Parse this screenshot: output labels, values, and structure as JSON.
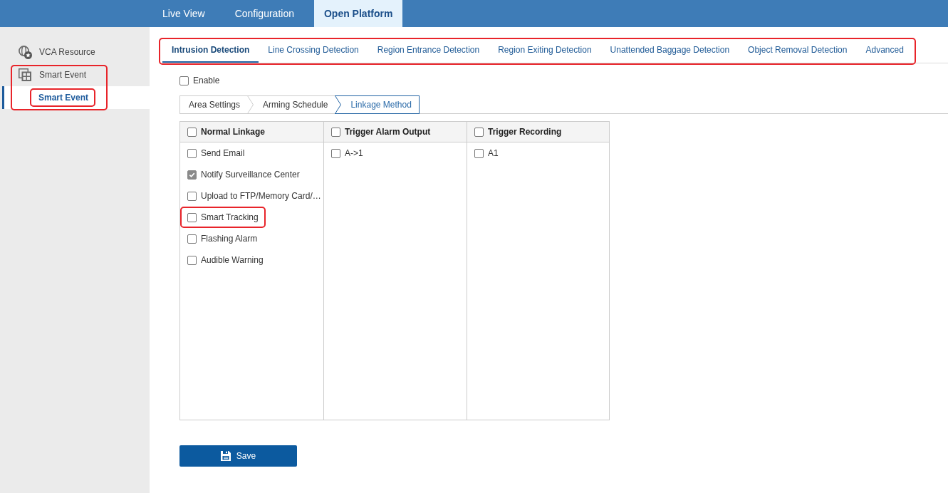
{
  "top_nav": {
    "items": [
      {
        "label": "Live View",
        "selected": false
      },
      {
        "label": "Configuration",
        "selected": false
      },
      {
        "label": "Open Platform",
        "selected": true
      }
    ]
  },
  "sidebar": {
    "items": [
      {
        "label": "VCA Resource",
        "selected": false,
        "highlighted": false
      },
      {
        "label": "Smart Event",
        "selected": false,
        "highlighted": true,
        "children": [
          {
            "label": "Smart Event",
            "selected": true,
            "highlighted": true
          }
        ]
      }
    ]
  },
  "detection_tabs": {
    "highlighted": true,
    "items": [
      {
        "label": "Intrusion Detection",
        "selected": true
      },
      {
        "label": "Line Crossing Detection",
        "selected": false
      },
      {
        "label": "Region Entrance Detection",
        "selected": false
      },
      {
        "label": "Region Exiting Detection",
        "selected": false
      },
      {
        "label": "Unattended Baggage Detection",
        "selected": false
      },
      {
        "label": "Object Removal Detection",
        "selected": false
      },
      {
        "label": "Advanced",
        "selected": false
      }
    ]
  },
  "enable": {
    "label": "Enable",
    "checked": false
  },
  "steps": [
    {
      "label": "Area Settings",
      "selected": false
    },
    {
      "label": "Arming Schedule",
      "selected": false
    },
    {
      "label": "Linkage Method",
      "selected": true
    }
  ],
  "linkage_table": {
    "columns": [
      {
        "label": "Normal Linkage",
        "checked": false,
        "options": [
          {
            "label": "Send Email",
            "checked": false,
            "highlighted": false
          },
          {
            "label": "Notify Surveillance Center",
            "checked": true,
            "highlighted": false
          },
          {
            "label": "Upload to FTP/Memory Card/…",
            "checked": false,
            "highlighted": false
          },
          {
            "label": "Smart Tracking",
            "checked": false,
            "highlighted": true
          },
          {
            "label": "Flashing Alarm",
            "checked": false,
            "highlighted": false
          },
          {
            "label": "Audible Warning",
            "checked": false,
            "highlighted": false
          }
        ]
      },
      {
        "label": "Trigger Alarm Output",
        "checked": false,
        "options": [
          {
            "label": "A->1",
            "checked": false,
            "highlighted": false
          }
        ]
      },
      {
        "label": "Trigger Recording",
        "checked": false,
        "options": [
          {
            "label": "A1",
            "checked": false,
            "highlighted": false
          }
        ]
      }
    ]
  },
  "save_button": {
    "label": "Save"
  }
}
